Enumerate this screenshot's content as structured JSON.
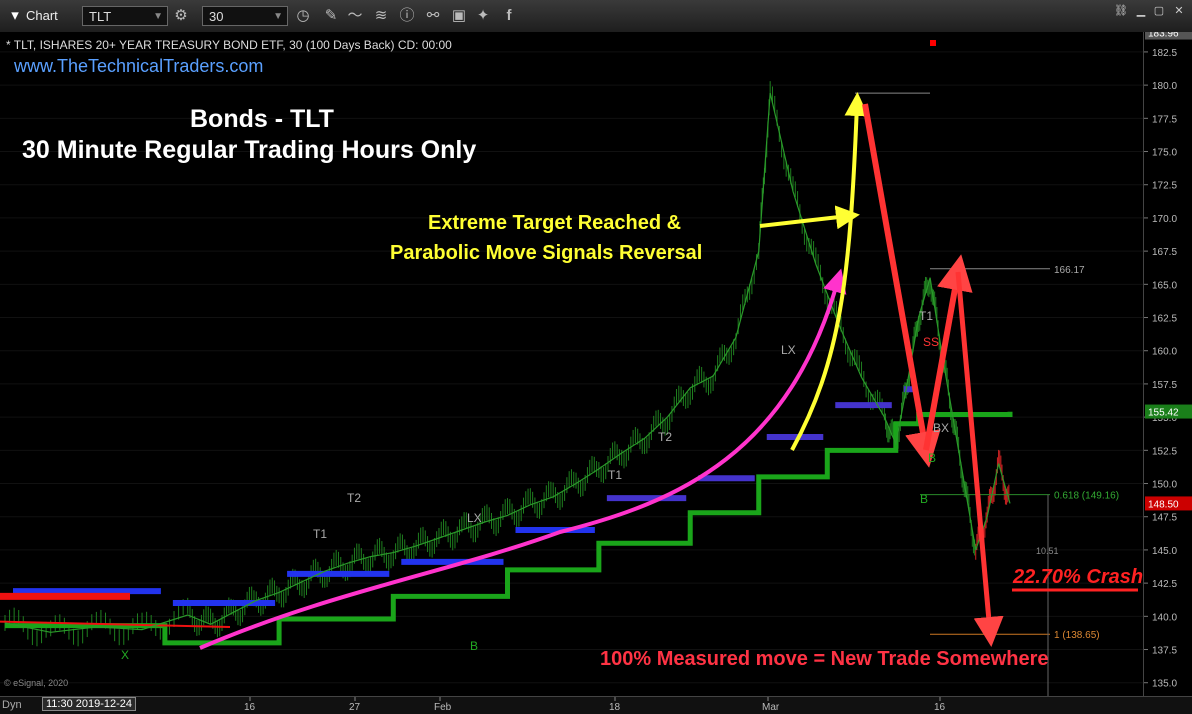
{
  "toolbar": {
    "app_title": "Chart",
    "symbol": "TLT",
    "interval": "30",
    "icons": [
      "gear-icon",
      "search-icon",
      "pencil-icon",
      "trend-icon",
      "info-icon",
      "link-icon",
      "note-icon",
      "twitter-icon",
      "facebook-icon"
    ]
  },
  "header": {
    "title_line": "* TLT, ISHARES 20+ YEAR TREASURY BOND ETF, 30 (100 Days Back) CD: 00:00",
    "website": "www.TheTechnicalTraders.com"
  },
  "annotations": {
    "title1": "Bonds - TLT",
    "title2": "30 Minute Regular Trading Hours Only",
    "extreme1": "Extreme Target Reached &",
    "extreme2": "Parabolic Move Signals Reversal",
    "crash": "22.70% Crash",
    "measured": "100% Measured move = New Trade Somewhere",
    "copyright": "© eSignal, 2020",
    "dyn": "Dyn",
    "cursor_time": "11:30 2019-12-24"
  },
  "chart_data": {
    "type": "line",
    "symbol": "TLT",
    "interval_minutes": 30,
    "ylim": [
      134,
      184
    ],
    "y_ticks": [
      135.0,
      137.5,
      140.0,
      142.5,
      145.0,
      147.5,
      150.0,
      152.5,
      155.0,
      157.5,
      160.0,
      162.5,
      165.0,
      167.5,
      170.0,
      172.5,
      175.0,
      177.5,
      180.0,
      182.5
    ],
    "x_ticks": [
      "16",
      "27",
      "Feb",
      "18",
      "Mar",
      "16"
    ],
    "price_labels": [
      {
        "value": 183.96,
        "text": "183.96",
        "color": "#555555"
      },
      {
        "value": 155.42,
        "text": "155.42",
        "color": "#1a7f1a"
      },
      {
        "value": 148.5,
        "text": "148.50",
        "color": "#cc0000"
      }
    ],
    "price_series": [
      {
        "x": 0,
        "y": 139.5
      },
      {
        "x": 4,
        "y": 138.8
      },
      {
        "x": 8,
        "y": 139.2
      },
      {
        "x": 12,
        "y": 139.0
      },
      {
        "x": 16,
        "y": 140.1
      },
      {
        "x": 18,
        "y": 139.4
      },
      {
        "x": 20,
        "y": 140.3
      },
      {
        "x": 22,
        "y": 141.2
      },
      {
        "x": 24,
        "y": 141.8
      },
      {
        "x": 26,
        "y": 142.6
      },
      {
        "x": 28,
        "y": 143.4
      },
      {
        "x": 30,
        "y": 144.0
      },
      {
        "x": 32,
        "y": 144.5
      },
      {
        "x": 34,
        "y": 144.8
      },
      {
        "x": 36,
        "y": 145.3
      },
      {
        "x": 38,
        "y": 145.9
      },
      {
        "x": 40,
        "y": 146.5
      },
      {
        "x": 42,
        "y": 147.1
      },
      {
        "x": 44,
        "y": 147.6
      },
      {
        "x": 46,
        "y": 148.4
      },
      {
        "x": 48,
        "y": 149.0
      },
      {
        "x": 50,
        "y": 150.0
      },
      {
        "x": 52,
        "y": 151.1
      },
      {
        "x": 54,
        "y": 152.3
      },
      {
        "x": 56,
        "y": 153.4
      },
      {
        "x": 58,
        "y": 155.0
      },
      {
        "x": 60,
        "y": 157.2
      },
      {
        "x": 62,
        "y": 158.1
      },
      {
        "x": 64,
        "y": 161.0
      },
      {
        "x": 66,
        "y": 167.5
      },
      {
        "x": 67,
        "y": 179.4
      },
      {
        "x": 69,
        "y": 172.0
      },
      {
        "x": 71,
        "y": 166.5
      },
      {
        "x": 73,
        "y": 162.0
      },
      {
        "x": 75,
        "y": 158.0
      },
      {
        "x": 77,
        "y": 155.0
      },
      {
        "x": 78,
        "y": 153.0
      },
      {
        "x": 79,
        "y": 157.5
      },
      {
        "x": 80,
        "y": 162.5
      },
      {
        "x": 81,
        "y": 165.5
      },
      {
        "x": 82,
        "y": 160.0
      },
      {
        "x": 83,
        "y": 155.0
      },
      {
        "x": 84,
        "y": 150.0
      },
      {
        "x": 85,
        "y": 145.0
      },
      {
        "x": 86,
        "y": 147.5
      },
      {
        "x": 87,
        "y": 151.5
      },
      {
        "x": 88,
        "y": 148.5
      }
    ],
    "support_green": [
      {
        "x": 0,
        "y": 139.3
      },
      {
        "x": 14,
        "y": 138.0
      },
      {
        "x": 24,
        "y": 139.8
      },
      {
        "x": 34,
        "y": 141.5
      },
      {
        "x": 44,
        "y": 143.5
      },
      {
        "x": 52,
        "y": 145.5
      },
      {
        "x": 60,
        "y": 147.8
      },
      {
        "x": 66,
        "y": 150.5
      },
      {
        "x": 72,
        "y": 152.5
      },
      {
        "x": 78,
        "y": 154.5
      },
      {
        "x": 80,
        "y": 155.2
      },
      {
        "x": 88,
        "y": 155.4
      }
    ],
    "resistance_red": [
      {
        "x": 0,
        "y": 141.5
      },
      {
        "x": 10,
        "y": 141.4
      },
      {
        "x": 10,
        "y": 140.5
      },
      {
        "x": 16,
        "y": 139.2
      }
    ],
    "levels": [
      {
        "name": "166.17",
        "value": 166.17
      },
      {
        "name": "0.618 (149.16)",
        "value": 149.16
      },
      {
        "name": "1 (138.65)",
        "value": 138.65
      },
      {
        "name": "10.51",
        "value": 145.0
      }
    ],
    "signal_labels": [
      "T1",
      "T2",
      "LX",
      "T1",
      "T2",
      "LX",
      "T1",
      "SS",
      "BX",
      "B",
      "X",
      "B",
      "B"
    ]
  }
}
